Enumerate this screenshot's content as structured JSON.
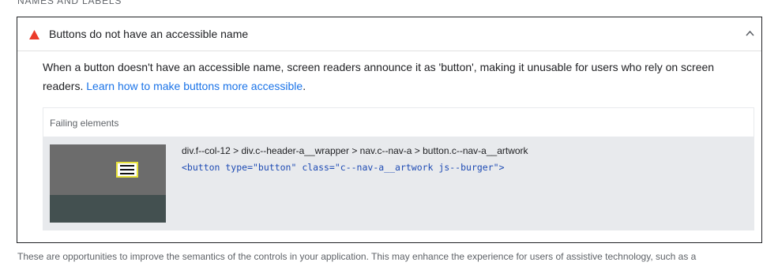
{
  "section": {
    "heading": "NAMES AND LABELS"
  },
  "audit": {
    "title": "Buttons do not have an accessible name",
    "status_color": "#eb3b2a",
    "description_text": "When a button doesn't have an accessible name, screen readers announce it as 'button', making it unusable for users who rely on screen readers. ",
    "description_link": "Learn how to make buttons more accessible",
    "description_end": "."
  },
  "details": {
    "header": "Failing elements",
    "items": [
      {
        "selector": "div.f--col-12 > div.c--header-a__wrapper > nav.c--nav-a > button.c--nav-a__artwork",
        "snippet": "<button type=\"button\" class=\"c--nav-a__artwork js--burger\">"
      }
    ]
  },
  "footer": {
    "text": "These are opportunities to improve the semantics of the controls in your application. This may enhance the experience for users of assistive technology, such as a"
  },
  "colors": {
    "link": "#1a73e8",
    "snippet": "#1e4bb4",
    "highlight": "#e8e23b"
  },
  "icons": {
    "status": "warning-triangle-icon",
    "toggle": "chevron-up-icon"
  }
}
